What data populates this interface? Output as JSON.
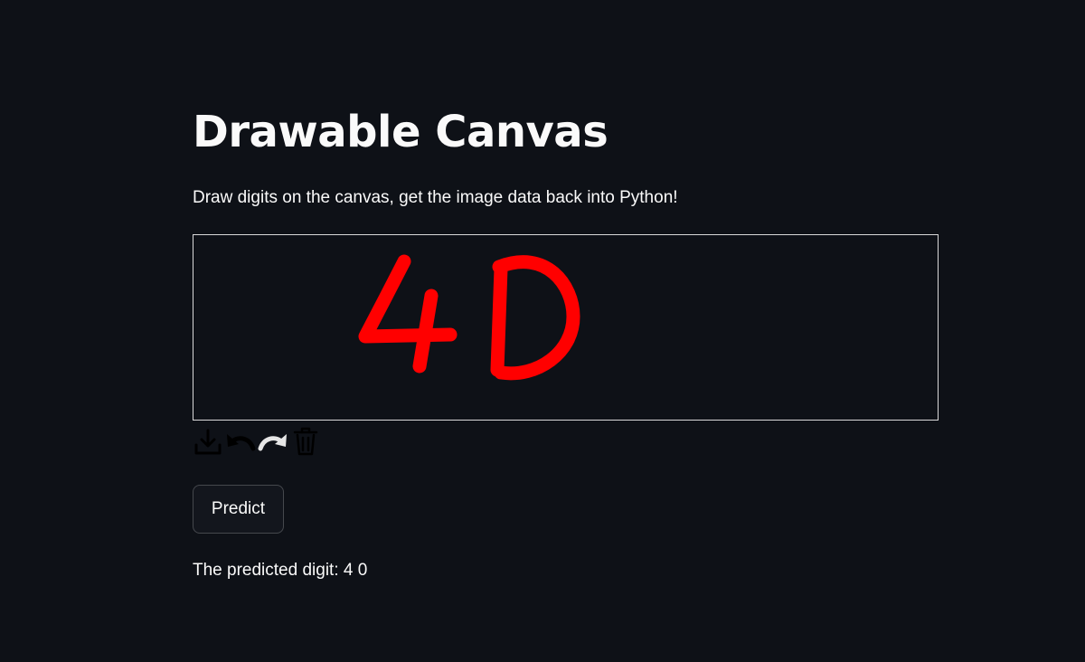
{
  "header": {
    "title": "Drawable Canvas",
    "subtitle": "Draw digits on the canvas, get the image data back into Python!"
  },
  "canvas": {
    "stroke_color": "#ff0000",
    "background_color": "#0e1117",
    "border_color": "#d9d9d9",
    "drawn_characters": "4D"
  },
  "toolbar": {
    "icons": [
      "download-icon",
      "undo-icon",
      "redo-icon",
      "trash-icon"
    ]
  },
  "predict_button": {
    "label": "Predict"
  },
  "result": {
    "text": "The predicted digit: 4 0"
  },
  "colors": {
    "background": "#0e1117",
    "text": "#fafafa",
    "stroke": "#ff0000"
  }
}
